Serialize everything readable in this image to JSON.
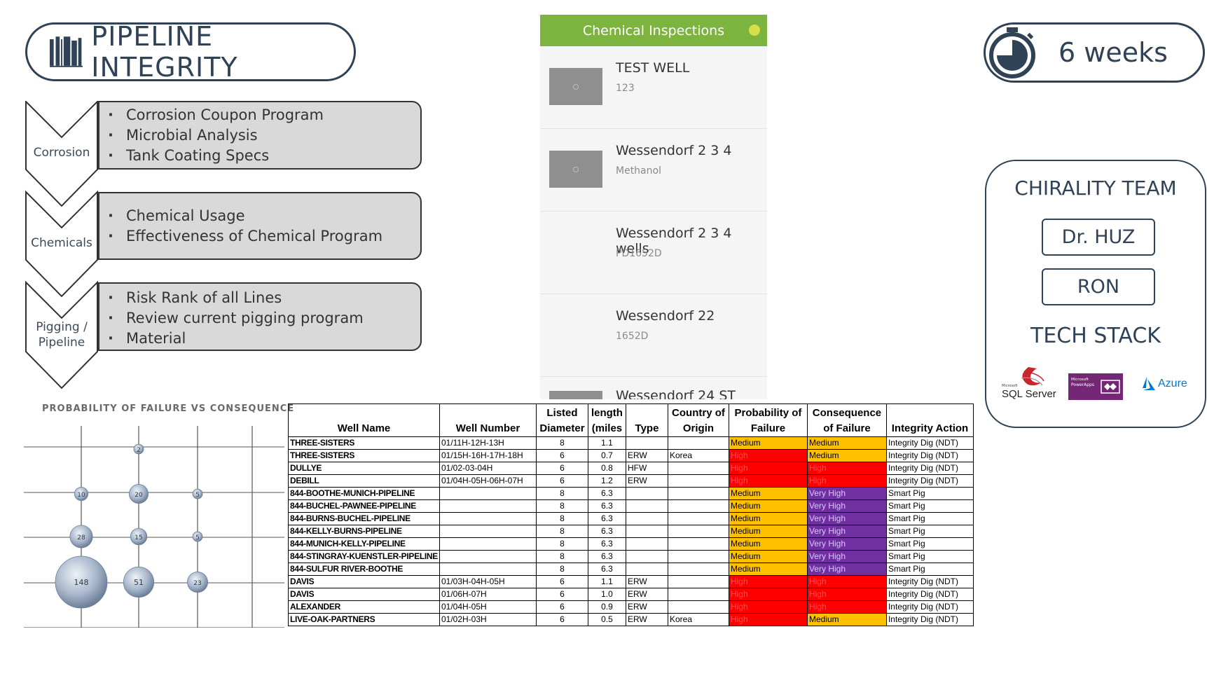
{
  "header": {
    "title": "PIPELINE INTEGRITY",
    "duration": "6 weeks"
  },
  "icons": {
    "title": "books-icon",
    "duration": "stopwatch-icon"
  },
  "categories": [
    {
      "label": "Corrosion",
      "bullets": [
        "Corrosion Coupon Program",
        "Microbial Analysis",
        "Tank Coating Specs"
      ]
    },
    {
      "label": "Chemicals",
      "bullets": [
        "Chemical Usage",
        "Effectiveness of Chemical Program"
      ]
    },
    {
      "label": "Pigging / Pipeline",
      "bullets": [
        "Risk Rank of all Lines",
        "Review current pigging program",
        "Material"
      ]
    }
  ],
  "app": {
    "title": "Chemical Inspections",
    "items": [
      {
        "name": "TEST WELL",
        "sub": "123",
        "has_image": true
      },
      {
        "name": "Wessendorf 2 3 4",
        "sub": "Methanol",
        "has_image": true
      },
      {
        "name": "Wessendorf 2 3 4 wells",
        "sub": "PD1652D",
        "has_image": false
      },
      {
        "name": "Wessendorf 22",
        "sub": "1652D",
        "has_image": false
      },
      {
        "name": "Wessendorf 24 ST",
        "sub": "",
        "has_image": true
      }
    ]
  },
  "team": {
    "title": "CHIRALITY TEAM",
    "members": [
      "Dr. HUZ",
      "RON"
    ],
    "stack_title": "TECH STACK",
    "stack": [
      {
        "name": "SQL Server",
        "sub": "Microsoft"
      },
      {
        "name": "PowerApps",
        "sub": "Microsoft"
      },
      {
        "name": "Azure",
        "sub": ""
      }
    ]
  },
  "chart_data": {
    "type": "bubble",
    "title": "PROBABILITY OF FAILURE VS CONSEQUENCE",
    "points": [
      {
        "col": 2,
        "row": 1,
        "value": 2
      },
      {
        "col": 1,
        "row": 2,
        "value": 10
      },
      {
        "col": 2,
        "row": 2,
        "value": 20
      },
      {
        "col": 3,
        "row": 2,
        "value": 5
      },
      {
        "col": 1,
        "row": 3,
        "value": 28
      },
      {
        "col": 2,
        "row": 3,
        "value": 15
      },
      {
        "col": 3,
        "row": 3,
        "value": 5
      },
      {
        "col": 1,
        "row": 4,
        "value": 148
      },
      {
        "col": 2,
        "row": 4,
        "value": 51
      },
      {
        "col": 3,
        "row": 4,
        "value": 23
      }
    ],
    "bubble_color": "#9fb0c8"
  },
  "table": {
    "headers": [
      "Well Name",
      "Well Number",
      "Listed Diameter",
      "length (miles",
      "Type",
      "Country of Origin",
      "Probability of Failure",
      "Consequence of Failure",
      "Integrity Action"
    ],
    "rows": [
      [
        "THREE-SISTERS",
        "01/11H-12H-13H",
        "8",
        "1.1",
        "",
        "",
        "Medium",
        "Medium",
        "Integrity Dig (NDT)"
      ],
      [
        "THREE-SISTERS",
        "01/15H-16H-17H-18H",
        "6",
        "0.7",
        "ERW",
        "Korea",
        "High",
        "Medium",
        "Integrity Dig (NDT)"
      ],
      [
        "DULLYE",
        "01/02-03-04H",
        "6",
        "0.8",
        "HFW",
        "",
        "High",
        "High",
        "Integrity Dig (NDT)"
      ],
      [
        "DEBILL",
        "01/04H-05H-06H-07H",
        "6",
        "1.2",
        "ERW",
        "",
        "High",
        "High",
        "Integrity Dig (NDT)"
      ],
      [
        "844-BOOTHE-MUNICH-PIPELINE",
        "",
        "8",
        "6.3",
        "",
        "",
        "Medium",
        "Very High",
        "Smart Pig"
      ],
      [
        "844-BUCHEL-PAWNEE-PIPELINE",
        "",
        "8",
        "6.3",
        "",
        "",
        "Medium",
        "Very High",
        "Smart Pig"
      ],
      [
        "844-BURNS-BUCHEL-PIPELINE",
        "",
        "8",
        "6.3",
        "",
        "",
        "Medium",
        "Very High",
        "Smart Pig"
      ],
      [
        "844-KELLY-BURNS-PIPELINE",
        "",
        "8",
        "6.3",
        "",
        "",
        "Medium",
        "Very High",
        "Smart Pig"
      ],
      [
        "844-MUNICH-KELLY-PIPELINE",
        "",
        "8",
        "6.3",
        "",
        "",
        "Medium",
        "Very High",
        "Smart Pig"
      ],
      [
        "844-STINGRAY-KUENSTLER-PIPELINE",
        "",
        "8",
        "6.3",
        "",
        "",
        "Medium",
        "Very High",
        "Smart Pig"
      ],
      [
        "844-SULFUR RIVER-BOOTHE",
        "",
        "8",
        "6.3",
        "",
        "",
        "Medium",
        "Very High",
        "Smart Pig"
      ],
      [
        "DAVIS",
        "01/03H-04H-05H",
        "6",
        "1.1",
        "ERW",
        "",
        "High",
        "High",
        "Integrity Dig (NDT)"
      ],
      [
        "DAVIS",
        "01/06H-07H",
        "6",
        "1.0",
        "ERW",
        "",
        "High",
        "High",
        "Integrity Dig (NDT)"
      ],
      [
        "ALEXANDER",
        "01/04H-05H",
        "6",
        "0.9",
        "ERW",
        "",
        "High",
        "High",
        "Integrity Dig (NDT)"
      ],
      [
        "LIVE-OAK-PARTNERS",
        "01/02H-03H",
        "6",
        "0.5",
        "ERW",
        "Korea",
        "High",
        "Medium",
        "Integrity Dig (NDT)"
      ]
    ],
    "level_colors": {
      "Medium": "#ffc000",
      "High": "#ff0000",
      "Very High": "#7030a0"
    }
  }
}
